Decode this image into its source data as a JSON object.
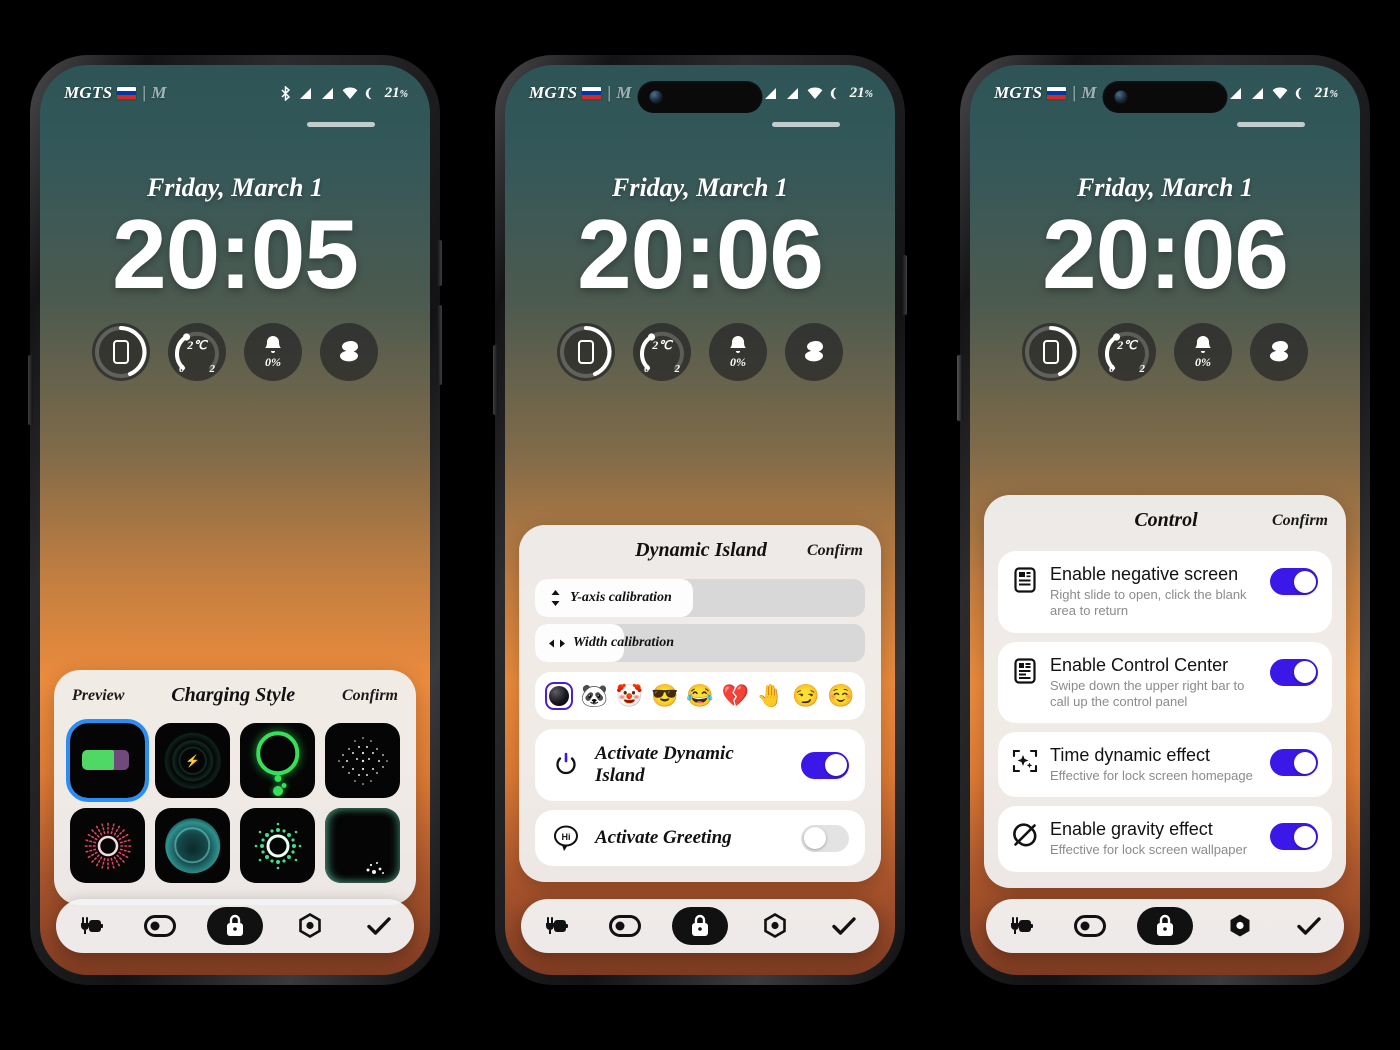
{
  "status": {
    "carrier": "MGTS",
    "separator": "|",
    "carrier_second": "M",
    "flag_icon": "russia-flag-icon",
    "icons": [
      "bluetooth-icon",
      "signal-icon",
      "signal-icon",
      "wifi-icon",
      "moon-icon"
    ],
    "battery": "21",
    "battery_unit": "%"
  },
  "lockscreen": {
    "date": "Friday, March 1",
    "time_1": "20:05",
    "time_2": "20:06",
    "time_3": "20:06",
    "widgets": [
      {
        "name": "phone-storage-widget",
        "icon": "phone-icon"
      },
      {
        "name": "temperature-widget",
        "icon": "temperature-gauge-icon",
        "value": "2℃",
        "min": "0",
        "max": "2"
      },
      {
        "name": "notification-widget",
        "icon": "bell-icon",
        "value": "0%"
      },
      {
        "name": "layers-widget",
        "icon": "layers-icon"
      }
    ]
  },
  "charging_sheet": {
    "preview_label": "Preview",
    "title": "Charging Style",
    "confirm_label": "Confirm",
    "styles": [
      {
        "name": "battery-style",
        "selected": true
      },
      {
        "name": "ripple-style",
        "selected": false
      },
      {
        "name": "green-ring-style",
        "selected": false
      },
      {
        "name": "dot-cloud-style",
        "selected": false
      },
      {
        "name": "red-burst-style",
        "selected": false
      },
      {
        "name": "teal-blob-style",
        "selected": false
      },
      {
        "name": "green-dot-ring-style",
        "selected": false
      },
      {
        "name": "edge-glow-style",
        "selected": false
      }
    ]
  },
  "island_sheet": {
    "title": "Dynamic Island",
    "confirm_label": "Confirm",
    "sliders": [
      {
        "label": "Y-axis calibration",
        "icon": "up-down-arrows-icon",
        "fill_pct": 48
      },
      {
        "label": "Width calibration",
        "icon": "left-right-arrows-icon",
        "fill_pct": 27
      }
    ],
    "emojis": [
      {
        "name": "camera-lens",
        "glyph": "",
        "selected": true
      },
      {
        "name": "panda",
        "glyph": "🐼",
        "selected": false
      },
      {
        "name": "clown",
        "glyph": "🤡",
        "selected": false
      },
      {
        "name": "sunglasses",
        "glyph": "😎",
        "selected": false
      },
      {
        "name": "joy",
        "glyph": "😂",
        "selected": false
      },
      {
        "name": "broken-heart",
        "glyph": "💔",
        "selected": false
      },
      {
        "name": "raised-hand",
        "glyph": "🤚",
        "selected": false
      },
      {
        "name": "smirk",
        "glyph": "😏",
        "selected": false
      },
      {
        "name": "relieved",
        "glyph": "☺️",
        "selected": false
      }
    ],
    "toggles": [
      {
        "label": "Activate Dynamic Island",
        "icon": "power-icon",
        "on": true
      },
      {
        "label": "Activate Greeting",
        "icon": "hi-bubble-icon",
        "on": false
      }
    ]
  },
  "control_sheet": {
    "title": "Control",
    "confirm_label": "Confirm",
    "items": [
      {
        "title": "Enable negative screen",
        "subtitle": "Right slide to open, click the blank area to return",
        "icon": "negative-screen-icon",
        "on": true
      },
      {
        "title": "Enable Control Center",
        "subtitle": "Swipe down the upper right bar to call up the control panel",
        "icon": "control-center-icon",
        "on": true
      },
      {
        "title": "Time dynamic effect",
        "subtitle": "Effective for lock screen homepage",
        "icon": "sparkle-frame-icon",
        "on": true
      },
      {
        "title": "Enable gravity effect",
        "subtitle": "Effective for lock screen wallpaper",
        "icon": "gravity-off-icon",
        "on": true
      }
    ]
  },
  "toolbar": {
    "items": [
      {
        "name": "charging-tab",
        "icon": "plug-icon",
        "active": false
      },
      {
        "name": "dynamic-island-tab",
        "icon": "pill-toggle-icon",
        "active": false
      },
      {
        "name": "lock-screen-tab",
        "icon": "lock-icon",
        "active": true
      },
      {
        "name": "control-tab",
        "icon": "hexagon-icon",
        "active": false
      },
      {
        "name": "apply-tab",
        "icon": "check-icon",
        "active": false
      }
    ]
  },
  "colors": {
    "accent_blue": "#3b18e8",
    "selection_blue": "#2a8cf5",
    "emoji_selection": "#4b1fd6",
    "sheet_bg": "#f1f1f1"
  }
}
